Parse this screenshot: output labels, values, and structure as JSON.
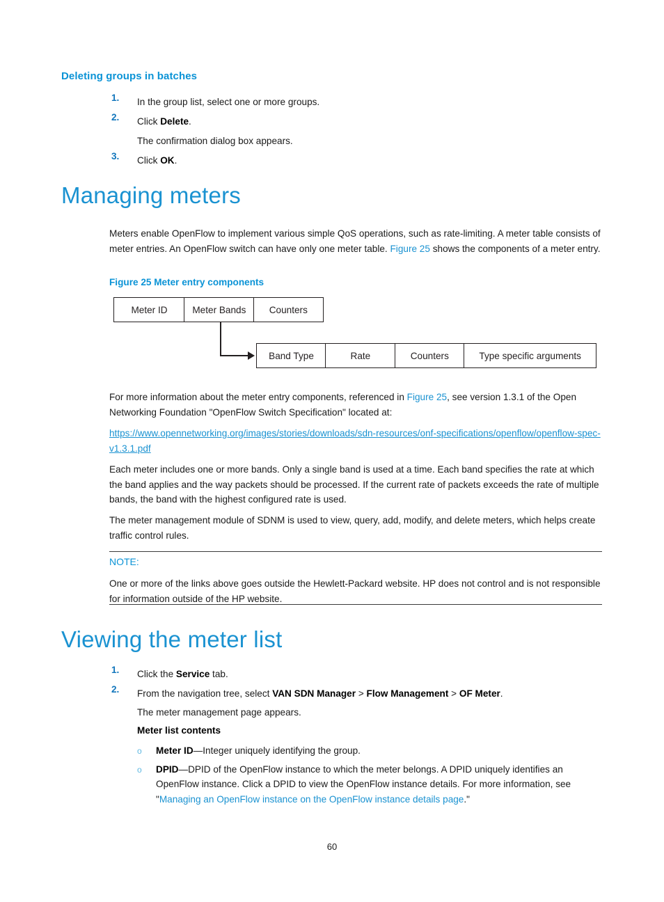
{
  "section_deleting": {
    "heading": "Deleting groups in batches",
    "steps": [
      {
        "num": "1.",
        "text": "In the group list, select one or more groups."
      },
      {
        "num": "2.",
        "text_prefix": "Click ",
        "bold": "Delete",
        "text_suffix": "."
      },
      {
        "num": "",
        "text": "The confirmation dialog box appears."
      },
      {
        "num": "3.",
        "text_prefix": "Click ",
        "bold": "OK",
        "text_suffix": "."
      }
    ],
    "step1_text": "In the group list, select one or more groups.",
    "step2_prefix": "Click ",
    "step2_bold": "Delete",
    "step2_suffix": ".",
    "step2_sub": "The confirmation dialog box appears.",
    "step3_prefix": "Click ",
    "step3_bold": "OK",
    "step3_suffix": "."
  },
  "section_managing": {
    "heading": "Managing meters",
    "intro_p1": "Meters enable OpenFlow to implement various simple QoS operations, such as rate-limiting. A meter table consists of meter entries. An OpenFlow switch can have only one meter table. ",
    "intro_link": "Figure 25",
    "intro_p1_end": " shows the components of a meter entry.",
    "figure_caption": "Figure 25 Meter entry components",
    "after_fig_a": "For more information about the meter entry components, referenced in ",
    "after_fig_link": "Figure 25",
    "after_fig_b": ", see version 1.3.1 of the Open Networking Foundation \"OpenFlow Switch Specification\" located at:",
    "url": "https://www.opennetworking.org/images/stories/downloads/sdn-resources/onf-specifications/openflow/openflow-spec-v1.3.1.pdf",
    "p_bands": "Each meter includes one or more bands. Only a single band is used at a time. Each band specifies the rate at which the band applies and the way packets should be processed. If the current rate of packets exceeds the rate of multiple bands, the band with the highest configured rate is used.",
    "p_module": "The meter management module of SDNM is used to view, query, add, modify, and delete meters, which helps create traffic control rules.",
    "note_label": "NOTE:",
    "note_text": "One or more of the links above goes outside the Hewlett-Packard website. HP does not control and is not responsible for information outside of the HP website."
  },
  "figure25": {
    "row1": [
      {
        "label": "Meter ID"
      },
      {
        "label": "Meter Bands"
      },
      {
        "label": "Counters"
      }
    ],
    "row2": [
      {
        "label": "Band Type"
      },
      {
        "label": "Rate"
      },
      {
        "label": "Counters"
      },
      {
        "label": "Type specific arguments"
      }
    ]
  },
  "section_viewing": {
    "heading": "Viewing the meter list",
    "step1_prefix": "Click the ",
    "step1_bold": "Service",
    "step1_suffix": " tab.",
    "step2_prefix": "From the navigation tree, select ",
    "step2_bold1": "VAN SDN Manager",
    "step2_sep1": " > ",
    "step2_bold2": "Flow Management",
    "step2_sep2": " > ",
    "step2_bold3": "OF Meter",
    "step2_suffix": ".",
    "step2_sub": "The meter management page appears.",
    "contents_heading": "Meter list contents",
    "bullets": [
      {
        "mark": "o",
        "bold": "Meter ID",
        "text": "—Integer uniquely identifying the group."
      },
      {
        "mark": "o",
        "bold": "DPID",
        "text": "—DPID of the OpenFlow instance to which the meter belongs. A DPID uniquely identifies an OpenFlow instance. Click a DPID to view the OpenFlow instance details. For more information, see \"",
        "link": "Managing an OpenFlow instance on the OpenFlow instance details page",
        "text_after": ".\""
      }
    ]
  },
  "footer": {
    "page_number": "60"
  },
  "colors": {
    "heading_blue": "#1a92d1",
    "subheading_blue": "#0b93d6",
    "number_blue": "#1276bc",
    "link_blue": "#1a92d1",
    "bullet_blue": "#5fb8e2",
    "text_black": "#1a1a1a",
    "diagram_stroke": "#231f20"
  }
}
